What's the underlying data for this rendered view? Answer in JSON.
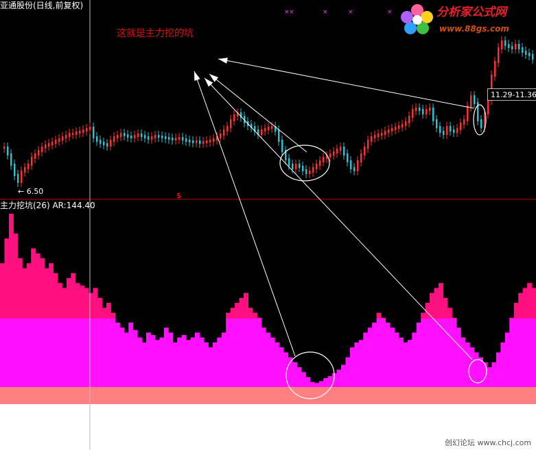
{
  "header": {
    "stock_title": "亚通股份(日线,前复权)",
    "annotation": "这就是主力挖的坑",
    "low_label": "← 6.50",
    "range_label": "11.29-11.36",
    "dollar_marker": "$"
  },
  "indicator": {
    "header": "主力挖坑(26) AR:144.40"
  },
  "logo": {
    "main": "分析家公式网",
    "url": "www.88gs.com"
  },
  "watermark": "创幻论坛 www.chcj.com",
  "colors": {
    "background": "#000000",
    "up_candle": "#ff3030",
    "down_candle": "#30c0d0",
    "divider": "#c00000",
    "hot_pink": "#ff1080",
    "magenta": "#ff10ff",
    "salmon": "#ff8080",
    "base_white": "#ffffff",
    "arrows": "#ffffff"
  },
  "indicator_series": {
    "name": "AR",
    "values": [
      250,
      300,
      350,
      310,
      260,
      240,
      250,
      280,
      270,
      260,
      240,
      250,
      230,
      210,
      200,
      220,
      230,
      210,
      205,
      200,
      190,
      200,
      180,
      160,
      170,
      150,
      130,
      120,
      110,
      130,
      115,
      100,
      90,
      110,
      105,
      95,
      100,
      120,
      110,
      90,
      100,
      105,
      95,
      100,
      110,
      100,
      90,
      80,
      90,
      100,
      110,
      150,
      160,
      170,
      180,
      190,
      160,
      150,
      140,
      120,
      110,
      100,
      90,
      80,
      70,
      60,
      50,
      40,
      30,
      20,
      10,
      8,
      12,
      18,
      22,
      28,
      35,
      45,
      60,
      80,
      90,
      95,
      110,
      120,
      130,
      150,
      140,
      130,
      120,
      110,
      100,
      90,
      95,
      110,
      130,
      150,
      170,
      190,
      200,
      210,
      180,
      160,
      140,
      120,
      100,
      90,
      80,
      70,
      60,
      50,
      40,
      50,
      70,
      90,
      110,
      140,
      170,
      190,
      200,
      210,
      200
    ]
  }
}
